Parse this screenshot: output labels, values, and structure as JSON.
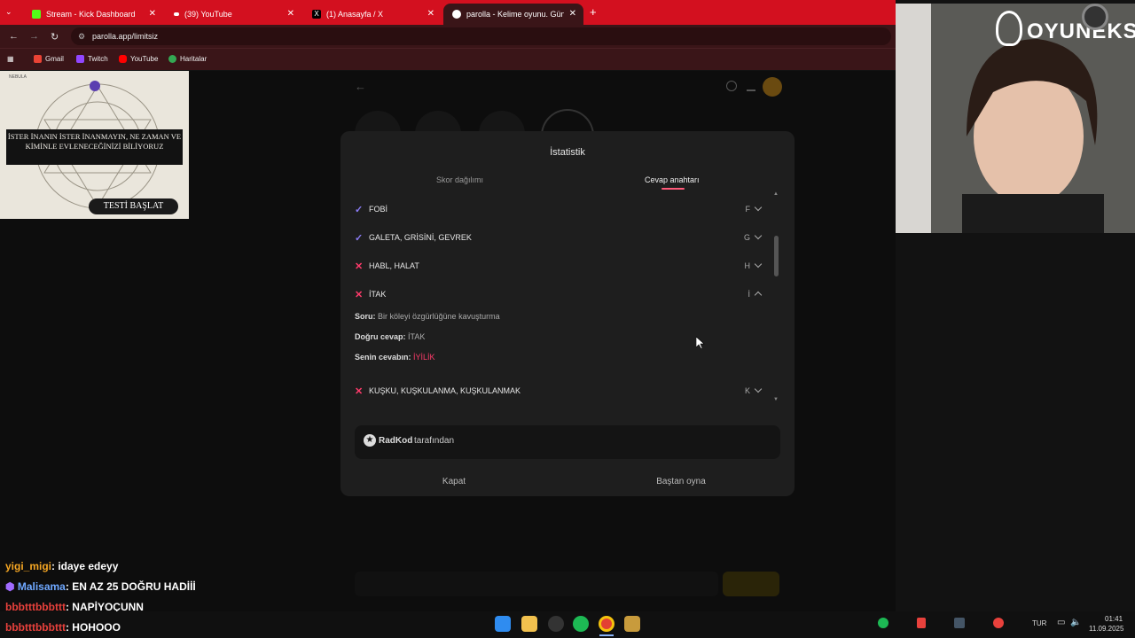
{
  "browser": {
    "tabs": [
      {
        "label": "Stream - Kick Dashboard",
        "icon": "kick-icon"
      },
      {
        "label": "(39) YouTube",
        "icon": "youtube-icon"
      },
      {
        "label": "(1) Anasayfa / X",
        "icon": "x-icon"
      },
      {
        "label": "parolla - Kelime oyunu. Günlük",
        "icon": "parolla-icon"
      }
    ],
    "url": "parolla.app/limitsiz",
    "bookmarks": [
      "Gmail",
      "Twitch",
      "YouTube",
      "Haritalar"
    ]
  },
  "ad": {
    "brand": "NEBULA",
    "headline": "İSTER İNANIN İSTER İNANMAYIN, NE ZAMAN VE KİMİNLE EVLENECEĞİNİZİ BİLİYORUZ",
    "cta": "TESTİ BAŞLAT"
  },
  "app": {
    "title": "parolla"
  },
  "modal": {
    "title": "İstatistik",
    "tabs": [
      "Skor dağılımı",
      "Cevap anahtarı"
    ],
    "rows": [
      {
        "status": "correct",
        "answer": "FOBİ",
        "letter": "F"
      },
      {
        "status": "correct",
        "answer": "GALETA, GRİSİNİ, GEVREK",
        "letter": "G"
      },
      {
        "status": "wrong",
        "answer": "HABL, HALAT",
        "letter": "H"
      },
      {
        "status": "wrong",
        "answer": "İTAK",
        "letter": "İ"
      },
      {
        "status": "wrong",
        "answer": "KUŞKU, KUŞKULANMA, KUŞKULANMAK",
        "letter": "K"
      }
    ],
    "expanded": {
      "question_label": "Soru:",
      "question": "Bir köleyi özgürlüğüne kavuşturma",
      "correct_label": "Doğru cevap:",
      "correct": "İTAK",
      "user_label": "Senin cevabın:",
      "user": "İYİLİK"
    },
    "author_name": "RadKod",
    "author_suffix": "tarafından",
    "close_label": "Kapat",
    "restart_label": "Baştan oyna",
    "colors": {
      "correct": "#8b7cf6",
      "wrong": "#ff3b6b",
      "accent": "#ff5a7a"
    }
  },
  "overlay": {
    "brand": "OYUNEKS"
  },
  "chat": [
    {
      "user": "yigi_migi",
      "message": ": idaye edeyy",
      "color": "#f5a623"
    },
    {
      "user": "Malisama",
      "message": ": EN AZ 25 DOĞRU HADİİİ",
      "color": "#6fa8ff"
    },
    {
      "user": "bbbtttbbbttt",
      "message": ": NAPİYOÇUNN",
      "color": "#e8413c"
    },
    {
      "user": "bbbtttbbbttt",
      "message": ": HOHOOO",
      "color": "#e8413c"
    }
  ],
  "taskbar": {
    "lang": "TUR",
    "time": "01:41",
    "date": "11.09.2025"
  }
}
